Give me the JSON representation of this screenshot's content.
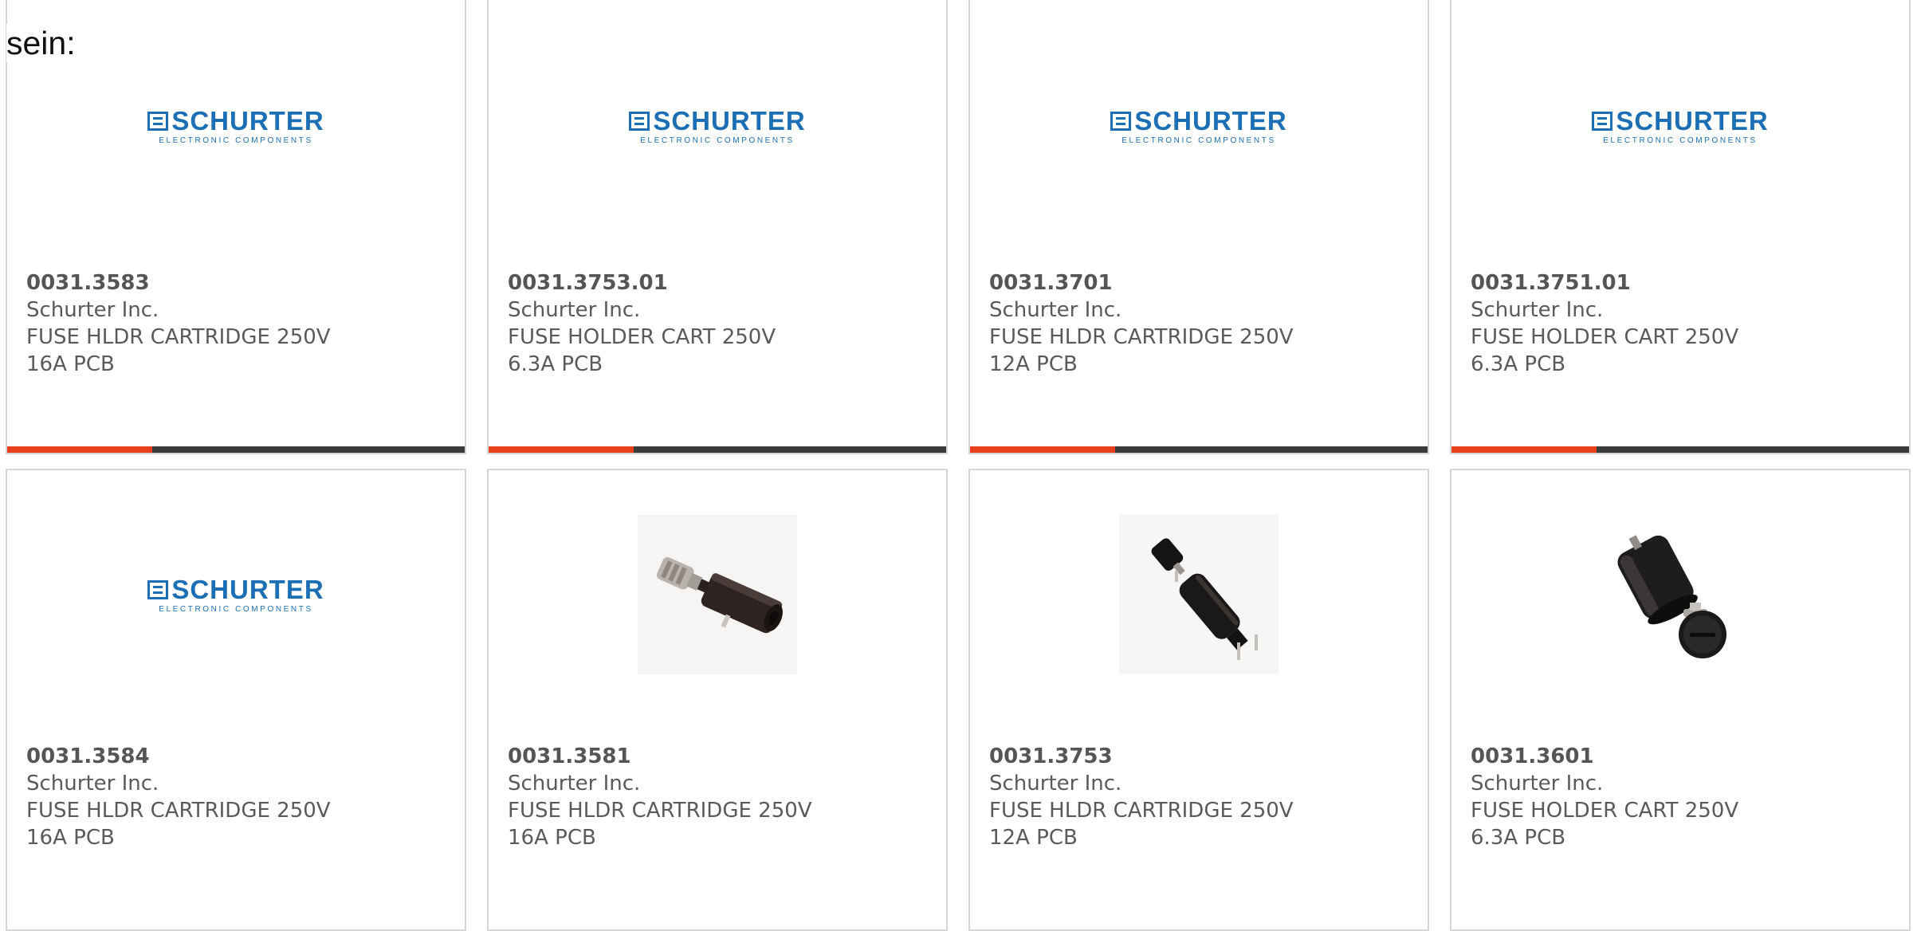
{
  "intro_text": "sein:",
  "colors": {
    "accent": "#e8401c",
    "bar": "#3a3a3a",
    "logo_blue": "#1c6fb5"
  },
  "logo": {
    "name": "SCHURTER",
    "tagline": "ELECTRONIC COMPONENTS"
  },
  "products": [
    {
      "part": "0031.3583",
      "maker": "Schurter Inc.",
      "desc": "FUSE HLDR CARTRIDGE 250V 16A PCB",
      "image": "schurter-logo"
    },
    {
      "part": "0031.3753.01",
      "maker": "Schurter Inc.",
      "desc": "FUSE HOLDER CART 250V 6.3A PCB",
      "image": "schurter-logo"
    },
    {
      "part": "0031.3701",
      "maker": "Schurter Inc.",
      "desc": "FUSE HLDR CARTRIDGE 250V 12A PCB",
      "image": "schurter-logo"
    },
    {
      "part": "0031.3751.01",
      "maker": "Schurter Inc.",
      "desc": "FUSE HOLDER CART 250V 6.3A PCB",
      "image": "schurter-logo"
    },
    {
      "part": "0031.3584",
      "maker": "Schurter Inc.",
      "desc": "FUSE HLDR CARTRIDGE 250V 16A PCB",
      "image": "schurter-logo"
    },
    {
      "part": "0031.3581",
      "maker": "Schurter Inc.",
      "desc": "FUSE HLDR CARTRIDGE 250V 16A PCB",
      "image": "fuse-holder-horizontal-photo"
    },
    {
      "part": "0031.3753",
      "maker": "Schurter Inc.",
      "desc": "FUSE HLDR CARTRIDGE 250V 12A PCB",
      "image": "fuse-holder-diagonal-photo"
    },
    {
      "part": "0031.3601",
      "maker": "Schurter Inc.",
      "desc": "FUSE HOLDER CART 250V 6.3A PCB",
      "image": "fuse-holder-cylinder-photo"
    }
  ]
}
